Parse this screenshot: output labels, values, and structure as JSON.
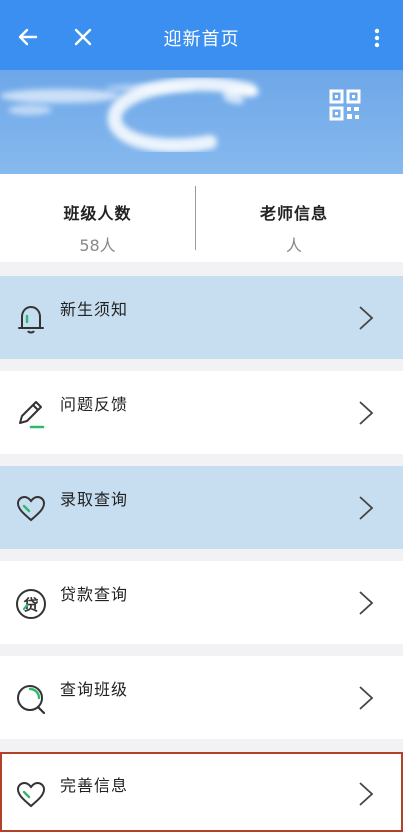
{
  "header": {
    "title": "迎新首页"
  },
  "stats": [
    {
      "label": "班级人数",
      "value": "58人"
    },
    {
      "label": "老师信息",
      "value": "人"
    }
  ],
  "menu": [
    {
      "label": "新生须知",
      "icon": "bell-icon"
    },
    {
      "label": "问题反馈",
      "icon": "pencil-icon"
    },
    {
      "label": "录取查询",
      "icon": "heart-icon"
    },
    {
      "label": "贷款查询",
      "icon": "loan-icon"
    },
    {
      "label": "查询班级",
      "icon": "search-icon"
    },
    {
      "label": "完善信息",
      "icon": "heart-icon"
    }
  ],
  "colors": {
    "header": "#3b8ff0",
    "highlight_row": "#c6def0",
    "accent": "#2dbb6b",
    "selected_border": "#b2412a"
  },
  "loan_icon_char": "贷"
}
